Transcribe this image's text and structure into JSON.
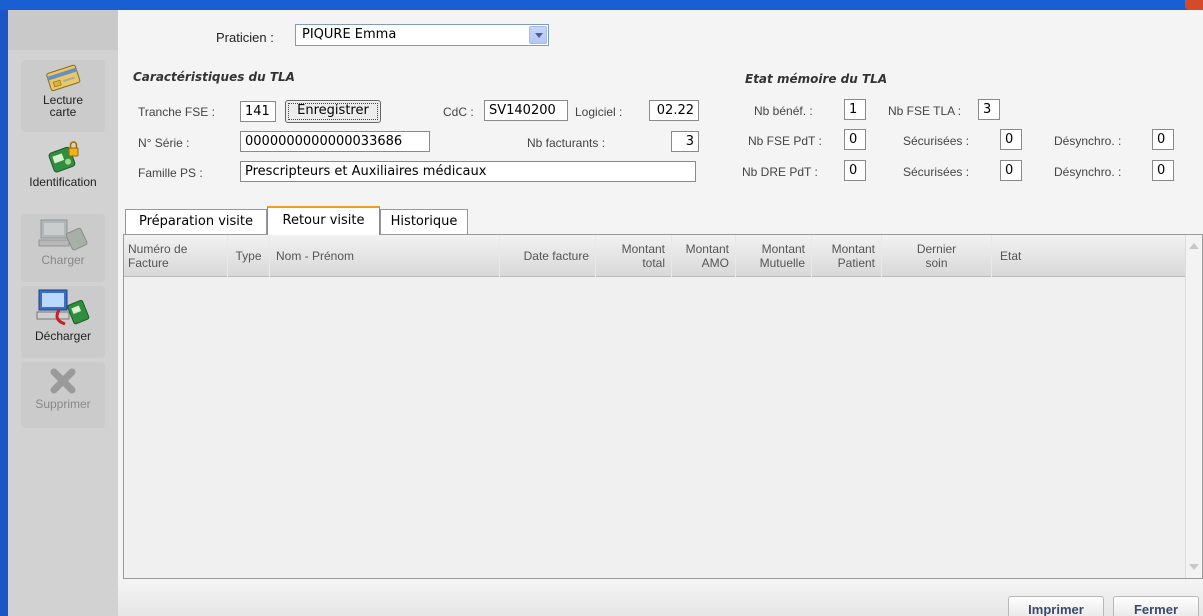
{
  "sidebar": {
    "buttons": [
      {
        "label": "Lecture",
        "label2": "carte",
        "icon": "card-reader-icon"
      },
      {
        "label": "Identification",
        "icon": "identification-icon"
      },
      {
        "label": "Charger",
        "icon": "load-device-icon",
        "disabled": true
      },
      {
        "label": "Décharger",
        "icon": "unload-device-icon"
      },
      {
        "label": "Supprimer",
        "icon": "delete-icon",
        "disabled": true
      }
    ]
  },
  "header": {
    "praticien_label": "Praticien :",
    "praticien_value": "PIQURE Emma"
  },
  "tla": {
    "title": "Caractéristiques du TLA",
    "tranche_label": "Tranche FSE :",
    "tranche_value": "141",
    "enregistrer_label": "Enregistrer",
    "cdc_label": "CdC :",
    "cdc_value": "SV140200",
    "logiciel_label": "Logiciel :",
    "logiciel_value": "02.22",
    "serie_label": "N° Série :",
    "serie_value": "0000000000000033686",
    "nb_facturants_label": "Nb facturants :",
    "nb_facturants_value": "3",
    "famille_label": "Famille PS :",
    "famille_value": "Prescripteurs et Auxiliaires médicaux"
  },
  "etat": {
    "title": "Etat mémoire du TLA",
    "nb_benef_label": "Nb bénéf. :",
    "nb_benef_value": "1",
    "nb_fse_tla_label": "Nb FSE TLA :",
    "nb_fse_tla_value": "3",
    "nb_fse_pdt_label": "Nb FSE PdT :",
    "nb_fse_pdt_value": "0",
    "securisees1_label": "Sécurisées :",
    "securisees1_value": "0",
    "desynchro1_label": "Désynchro. :",
    "desynchro1_value": "0",
    "nb_dre_pdt_label": "Nb DRE PdT :",
    "nb_dre_pdt_value": "0",
    "securisees2_label": "Sécurisées :",
    "securisees2_value": "0",
    "desynchro2_label": "Désynchro. :",
    "desynchro2_value": "0"
  },
  "tabs": [
    "Préparation visite",
    "Retour visite",
    "Historique"
  ],
  "active_tab": "Retour visite",
  "table": {
    "columns": [
      {
        "l1": "Numéro de",
        "l2": "Facture"
      },
      {
        "l1": "Type",
        "l2": ""
      },
      {
        "l1": "Nom - Prénom",
        "l2": ""
      },
      {
        "l1": "Date facture",
        "l2": ""
      },
      {
        "l1": "Montant",
        "l2": "total"
      },
      {
        "l1": "Montant",
        "l2": "AMO"
      },
      {
        "l1": "Montant",
        "l2": "Mutuelle"
      },
      {
        "l1": "Montant",
        "l2": "Patient"
      },
      {
        "l1": "Dernier",
        "l2": "soin"
      },
      {
        "l1": "Etat",
        "l2": ""
      }
    ],
    "rows": []
  },
  "footer": {
    "imprimer_label": "Imprimer",
    "fermer_label": "Fermer"
  },
  "colors": {
    "title_bar": "#1a5fd1",
    "active_tab_accent": "#f0a020",
    "footer_button_text": "#3a4a6b"
  }
}
